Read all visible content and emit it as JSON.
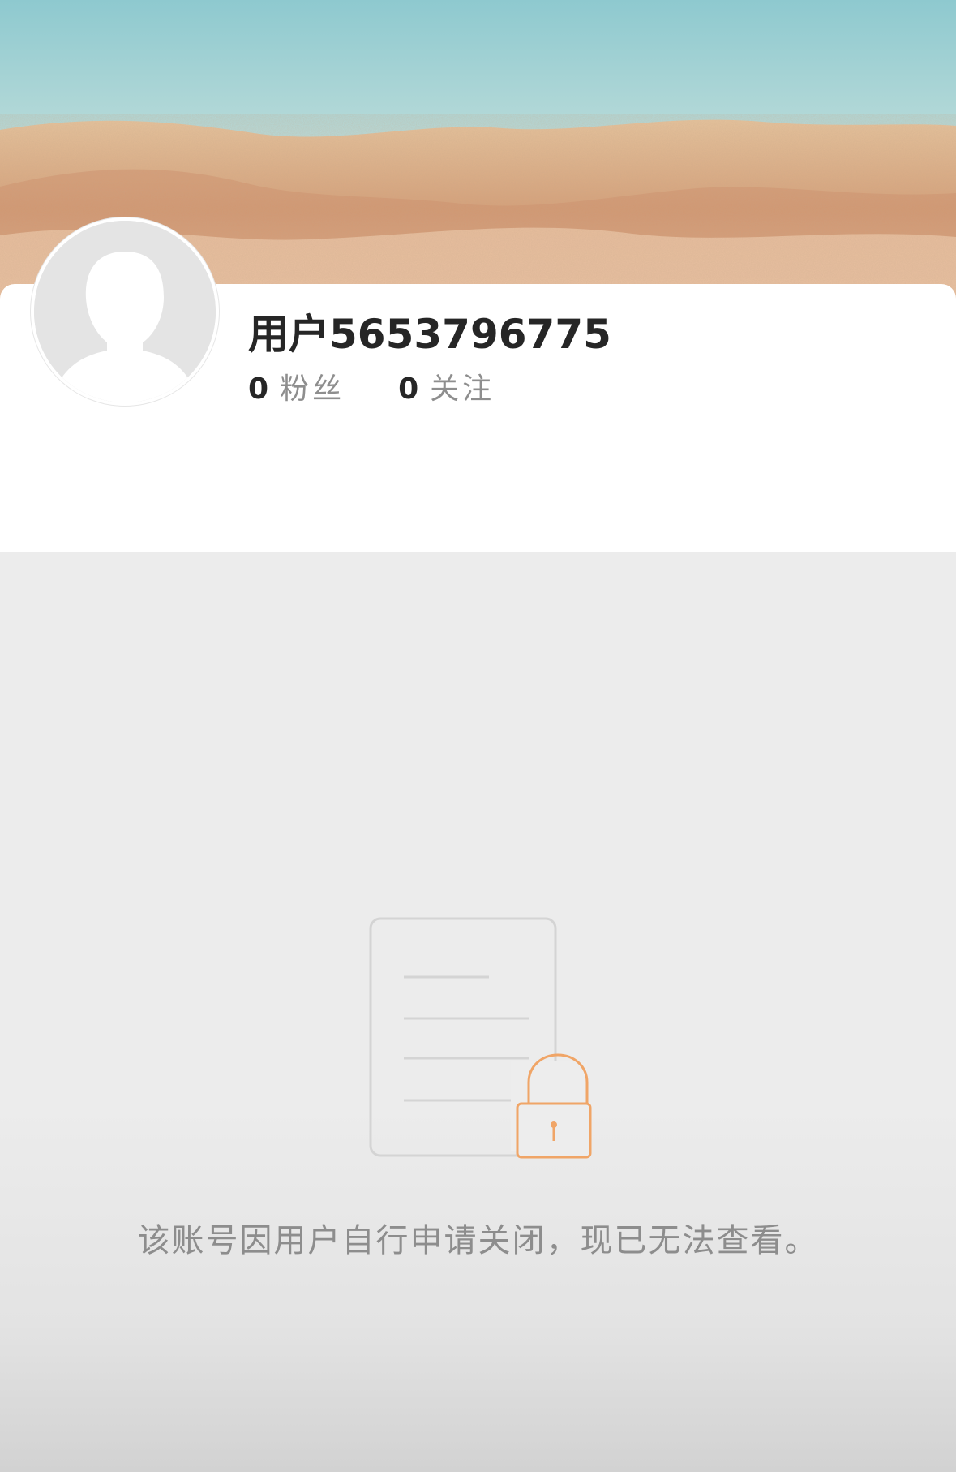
{
  "profile": {
    "username": "用户5653796775",
    "followers": {
      "count": "0",
      "label": "粉丝"
    },
    "following": {
      "count": "0",
      "label": "关注"
    }
  },
  "empty_state": {
    "message": "该账号因用户自行申请关闭，现已无法查看。",
    "icon": "locked-document-icon",
    "accent_color": "#f0a567"
  },
  "colors": {
    "background": "#ededed",
    "card": "#ffffff",
    "text_primary": "#262626",
    "text_secondary": "#8e8e8e"
  }
}
